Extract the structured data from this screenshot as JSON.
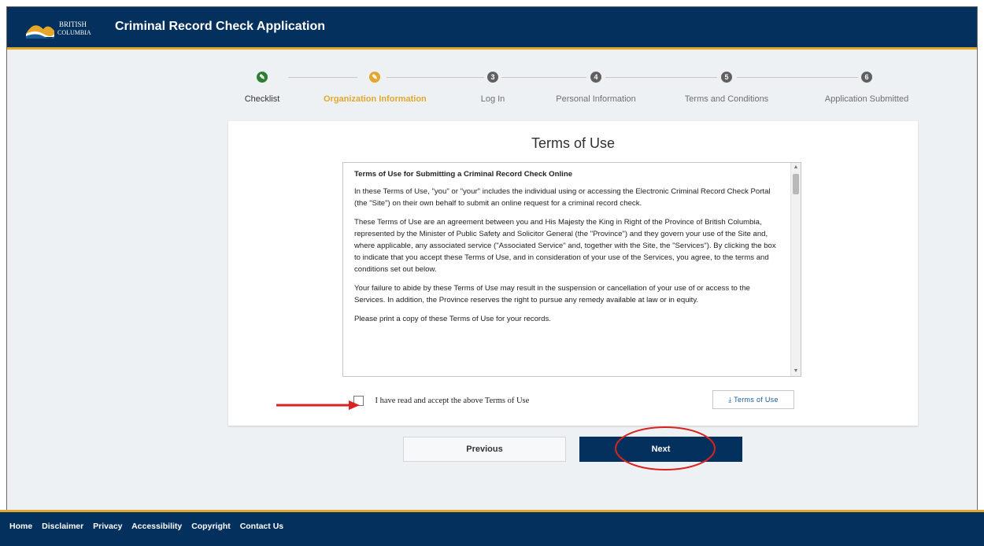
{
  "header": {
    "logo_text_top": "BRITISH",
    "logo_text_bottom": "COLUMBIA",
    "title": "Criminal Record Check Application"
  },
  "stepper": {
    "steps": [
      {
        "number": "1",
        "icon": "check-icon",
        "label": "Checklist",
        "state": "complete"
      },
      {
        "number": "2",
        "icon": "check-icon",
        "label": "Organization Information",
        "state": "active"
      },
      {
        "number": "3",
        "label": "Log In",
        "state": "upcoming"
      },
      {
        "number": "4",
        "label": "Personal Information",
        "state": "upcoming"
      },
      {
        "number": "5",
        "label": "Terms and Conditions",
        "state": "upcoming"
      },
      {
        "number": "6",
        "label": "Application Submitted",
        "state": "upcoming"
      }
    ]
  },
  "card": {
    "title": "Terms of Use",
    "terms": {
      "heading": "Terms of Use for Submitting a Criminal Record Check Online",
      "paragraphs": [
        "In these Terms of Use, \"you\" or \"your\" includes the individual using or accessing the Electronic Criminal Record Check Portal (the \"Site\") on their own behalf to submit an online request for a criminal record check.",
        "These Terms of Use are an agreement between you and His Majesty the King in Right of the Province of British Columbia, represented by the Minister of Public Safety and Solicitor General (the \"Province\") and they govern your use of the Site and, where applicable, any associated service (\"Associated Service\" and, together with the Site, the \"Services\"). By clicking the box to indicate that you accept these Terms of Use, and in consideration of your use of the Services, you agree, to the terms and conditions set out below.",
        "Your failure to abide by these Terms of Use may result in the suspension or cancellation of your use of or access to the Services. In addition, the Province reserves the right to pursue any remedy available at law or in equity.",
        "Please print a copy of these Terms of Use for your records."
      ]
    },
    "accept_label": "I have read and accept the above Terms of Use",
    "accept_checked": false,
    "download_label": "Terms of Use"
  },
  "nav": {
    "previous_label": "Previous",
    "next_label": "Next"
  },
  "footer": {
    "links": [
      "Home",
      "Disclaimer",
      "Privacy",
      "Accessibility",
      "Copyright",
      "Contact Us"
    ]
  },
  "colors": {
    "brand_navy": "#04305e",
    "brand_gold": "#e3a82b",
    "step_complete": "#2e7d32",
    "step_upcoming": "#606060",
    "annotation_red": "#d9231f"
  }
}
